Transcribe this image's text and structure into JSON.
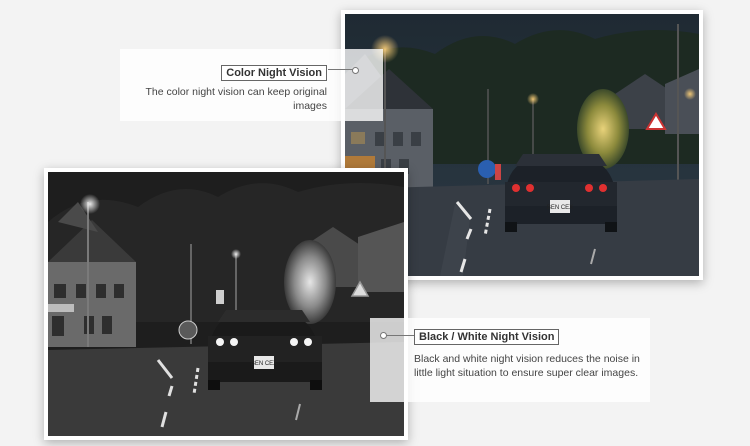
{
  "color_section": {
    "title": "Color Night Vision",
    "description": "The color night vision can keep original images",
    "image_alt": "night street photo in color"
  },
  "bw_section": {
    "title": "Black / White Night Vision",
    "description": "Black and white night vision reduces the noise in little light situation to ensure super clear images.",
    "image_alt": "night street photo in black and white"
  },
  "plate_text": "BEN CEX"
}
